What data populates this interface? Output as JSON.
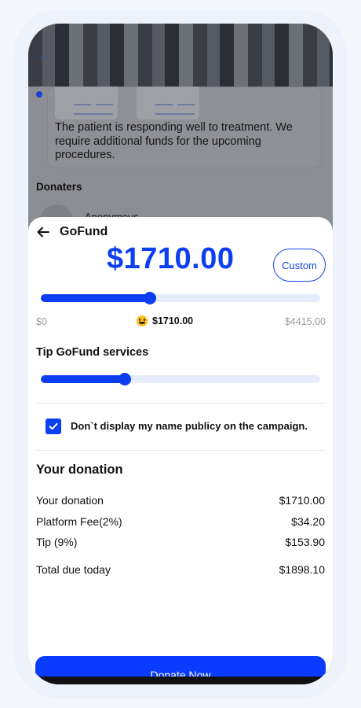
{
  "background": {
    "update_text": "The patient is responding well to treatment. We require additional funds for the upcoming procedures.",
    "donaters_title": "Donaters",
    "anonymous_label": "Anonymous"
  },
  "sheet": {
    "title": "GoFund",
    "amount": "$1710.00",
    "custom_label": "Custom",
    "donation_slider": {
      "min_label": "$0",
      "current_label": "$1710.00",
      "max_label": "$4415.00",
      "fill_fraction": 0.39
    },
    "tip_title": "Tip GoFund services",
    "tip_slider": {
      "fill_fraction": 0.3
    },
    "hide_name_checked": true,
    "hide_name_label": "Don`t display my name publicy on the campaign.",
    "summary_title": "Your donation",
    "summary_rows": [
      {
        "label": "Your donation",
        "value": "$1710.00"
      },
      {
        "label": "Platform Fee(2%)",
        "value": "$34.20"
      },
      {
        "label": "Tip (9%)",
        "value": "$153.90"
      }
    ],
    "total": {
      "label": "Total due today",
      "value": "$1898.10"
    },
    "donate_button": "Donate Now"
  },
  "colors": {
    "accent": "#0b3ff0",
    "track": "#e7ecfb",
    "muted": "#9a9ca4"
  },
  "icons": {
    "back": "arrow-left-icon",
    "emoji": "grinning-face-icon",
    "check": "checkmark-icon"
  }
}
